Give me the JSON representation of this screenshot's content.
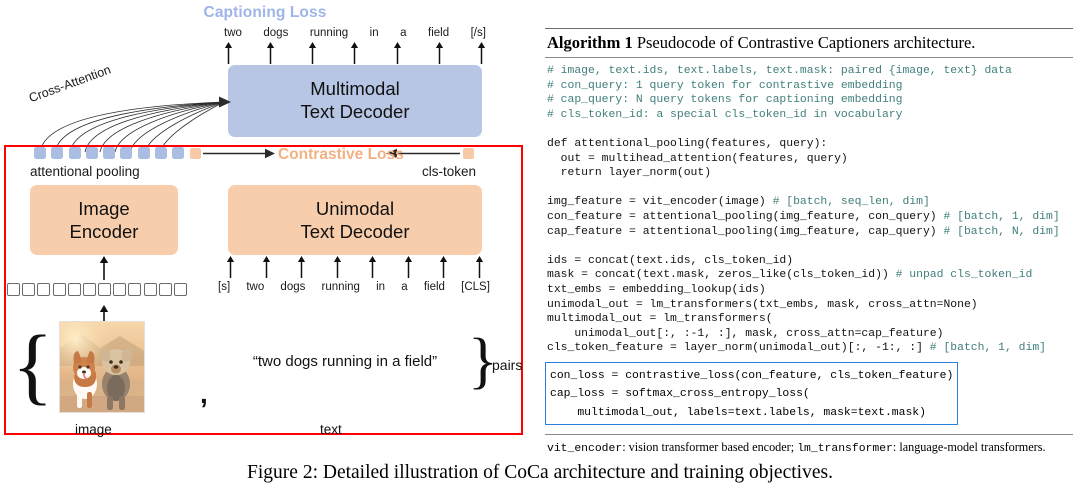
{
  "figure": {
    "caption": "Figure 2: Detailed illustration of CoCa architecture and training objectives."
  },
  "colors": {
    "multimodal_box": "#b6c6e4",
    "encoder_box": "#f7cdab",
    "contrastive_loss_text": "#f3b183",
    "captioning_loss_text": "#9fb4e8",
    "red_outline": "#ff0000",
    "code_comment": "#3f7e7c",
    "highlight_border": "#2b7fe0"
  },
  "diagram": {
    "captioning_loss_label": "Captioning Loss",
    "contrastive_loss_label": "Contrastive Loss",
    "cross_attention_label": "Cross-Attention",
    "attentional_pooling_label": "attentional pooling",
    "cls_token_label": "cls-token",
    "multimodal_box": {
      "line1": "Multimodal",
      "line2": "Text Decoder"
    },
    "image_encoder_box": {
      "line1": "Image",
      "line2": "Encoder"
    },
    "unimodal_box": {
      "line1": "Unimodal",
      "line2": "Text Decoder"
    },
    "output_tokens": [
      "two",
      "dogs",
      "running",
      "in",
      "a",
      "field",
      "[/s]"
    ],
    "input_tokens": [
      "[s]",
      "two",
      "dogs",
      "running",
      "in",
      "a",
      "field",
      "[CLS]"
    ],
    "pooling_square_count": 9,
    "patch_square_count": 12,
    "text_example": "“two dogs running in a field”",
    "comma": ",",
    "pairs_label": "pairs",
    "image_label": "image",
    "text_label": "text",
    "brace_left": "{",
    "brace_right": "}"
  },
  "algorithm": {
    "title_bold": "Algorithm 1",
    "title_rest": " Pseudocode of Contrastive Captioners architecture.",
    "code_block_1": "# image, text.ids, text.labels, text.mask: paired {image, text} data\n# con_query: 1 query token for contrastive embedding\n# cap_query: N query tokens for captioning embedding\n# cls_token_id: a special cls_token_id in vocabulary",
    "code_block_2": "def attentional_pooling(features, query):\n  out = multihead_attention(features, query)\n  return layer_norm(out)",
    "code_block_3_lines": [
      {
        "code": "img_feature = vit_encoder(image) ",
        "comment": "# [batch, seq_len, dim]"
      },
      {
        "code": "con_feature = attentional_pooling(img_feature, con_query) ",
        "comment": "# [batch, 1, dim]"
      },
      {
        "code": "cap_feature = attentional_pooling(img_feature, cap_query) ",
        "comment": "# [batch, N, dim]"
      }
    ],
    "code_block_4_lines": [
      {
        "code": "ids = concat(text.ids, cls_token_id)",
        "comment": ""
      },
      {
        "code": "mask = concat(text.mask, zeros_like(cls_token_id)) ",
        "comment": "# unpad cls_token_id"
      },
      {
        "code": "txt_embs = embedding_lookup(ids)",
        "comment": ""
      },
      {
        "code": "unimodal_out = lm_transformers(txt_embs, mask, cross_attn=None)",
        "comment": ""
      },
      {
        "code": "multimodal_out = lm_transformers(",
        "comment": ""
      },
      {
        "code": "    unimodal_out[:, :-1, :], mask, cross_attn=cap_feature)",
        "comment": ""
      },
      {
        "code": "cls_token_feature = layer_norm(unimodal_out)[:, -1:, :] ",
        "comment": "# [batch, 1, dim]"
      }
    ],
    "highlighted_loss_code": "con_loss = contrastive_loss(con_feature, cls_token_feature)\ncap_loss = softmax_cross_entropy_loss(\n    multimodal_out, labels=text.labels, mask=text.mask)",
    "footer_parts": {
      "mono1": "vit_encoder",
      "text1": ": vision transformer based encoder; ",
      "mono2": "lm_transformer",
      "text2": ": language-model transformers."
    }
  }
}
